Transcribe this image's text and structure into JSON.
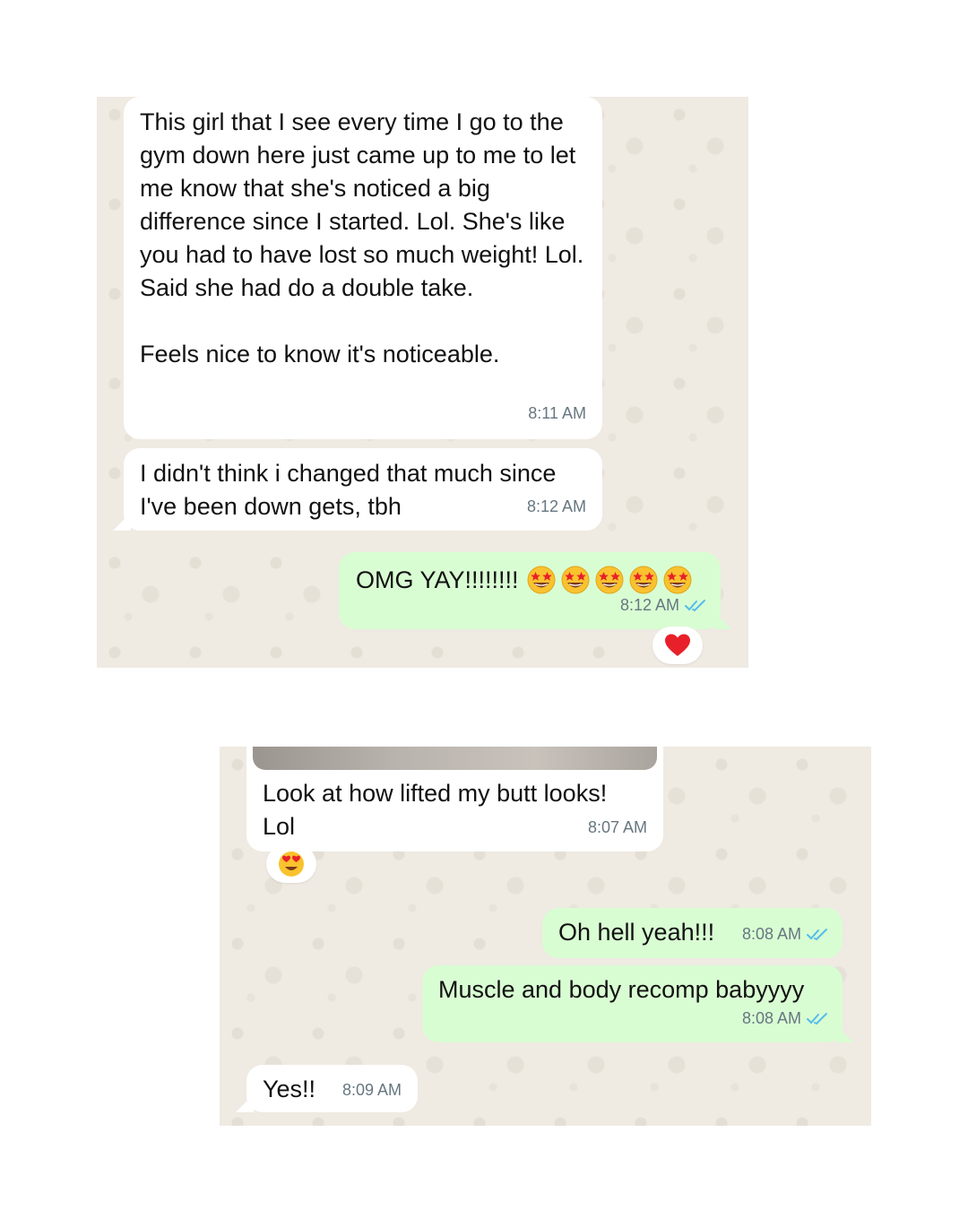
{
  "colors": {
    "chat_background": "#efeae2",
    "incoming_bubble": "#ffffff",
    "outgoing_bubble": "#d9fdd3",
    "read_ticks": "#53bdeb",
    "timestamp": "#667781"
  },
  "panel_1": {
    "messages": [
      {
        "direction": "incoming",
        "text": "This girl that I see every time I go to the gym down here just came up to me to let me know that she's noticed a big difference since I started. Lol. She's like you had to have lost so much weight! Lol. Said she had do a double take.\n\nFeels nice to know it's noticeable.",
        "time": "8:11 AM"
      },
      {
        "direction": "incoming",
        "text": "I didn't think i changed that much since I've been down gets, tbh",
        "time": "8:12 AM"
      },
      {
        "direction": "outgoing",
        "text": "OMG YAY!!!!!!!!",
        "emoji_icon": "star-struck-emoji",
        "emoji_count": 5,
        "time": "8:12 AM",
        "status": "read",
        "reaction_icon": "red-heart-emoji"
      }
    ]
  },
  "panel_2": {
    "messages": [
      {
        "direction": "incoming",
        "has_image_preview": true,
        "text": "Look at how lifted my butt looks! Lol",
        "time": "8:07 AM",
        "reaction_icon": "heart-eyes-emoji"
      },
      {
        "direction": "outgoing",
        "text": "Oh hell yeah!!!",
        "time": "8:08 AM",
        "status": "read"
      },
      {
        "direction": "outgoing",
        "text": "Muscle and body recomp babyyyy",
        "time": "8:08 AM",
        "status": "read"
      },
      {
        "direction": "incoming",
        "text": "Yes!!",
        "time": "8:09 AM"
      }
    ]
  }
}
